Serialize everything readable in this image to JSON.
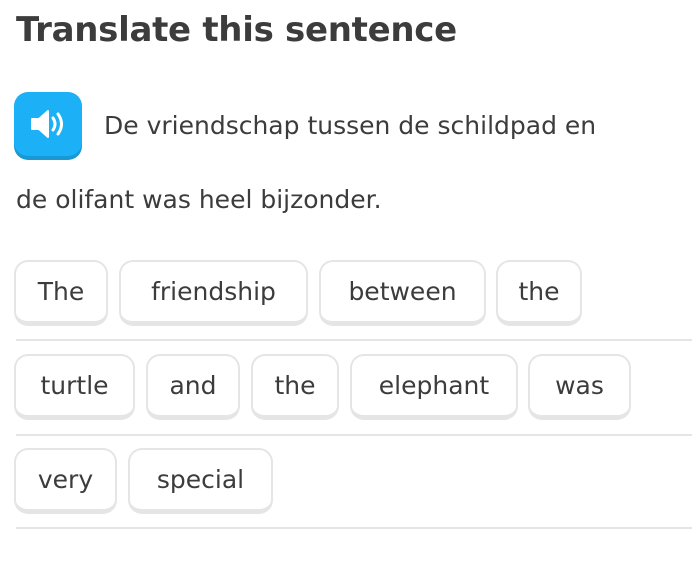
{
  "header": {
    "title": "Translate this sentence"
  },
  "prompt": {
    "audio_button_icon": "speaker-icon",
    "sentence_line_1": "De vriendschap tussen de schildpad en",
    "sentence_line_2": "de olifant was heel bijzonder."
  },
  "answer": {
    "words": [
      "The",
      "friendship",
      "between",
      "the",
      "turtle",
      "and",
      "the",
      "elephant",
      "was",
      "very",
      "special"
    ]
  },
  "colors": {
    "accent": "#1cb0f6",
    "accent_shadow": "#1899d6",
    "chip_border": "#e5e5e5",
    "text": "#3c3c3c"
  }
}
